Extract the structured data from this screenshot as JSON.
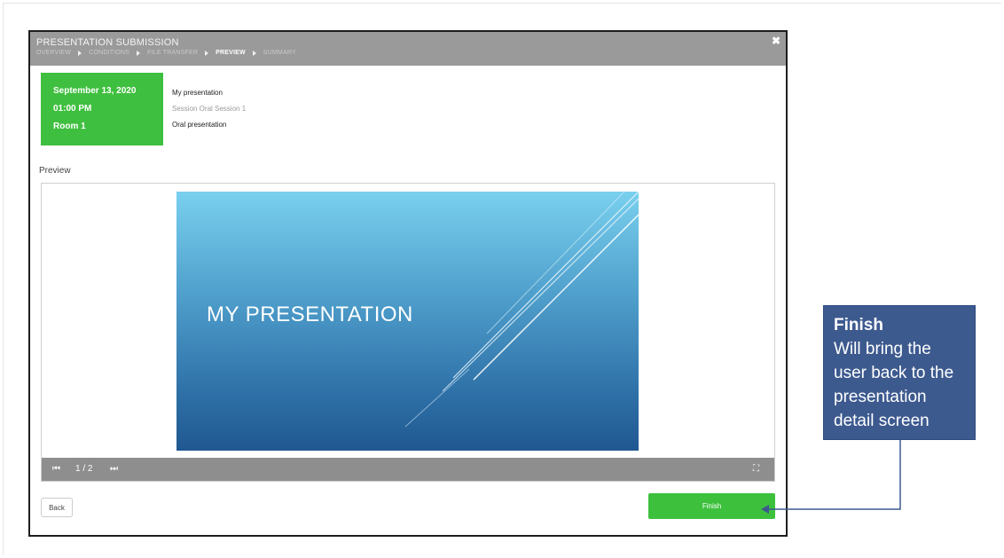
{
  "modal": {
    "title": "PRESENTATION SUBMISSION",
    "close_icon": "close-icon",
    "steps": [
      {
        "label": "OVERVIEW",
        "active": false
      },
      {
        "label": "CONDITIONS",
        "active": false
      },
      {
        "label": "FILE TRANSFER",
        "active": false
      },
      {
        "label": "PREVIEW",
        "active": true
      },
      {
        "label": "SUMMARY",
        "active": false
      }
    ]
  },
  "session": {
    "date": "September 13, 2020",
    "time": "01:00 PM",
    "room": "Room 1",
    "title": "My presentation",
    "session_name": "Session Oral Session 1",
    "type": "Oral presentation",
    "card_color": "#3fbf3f"
  },
  "preview": {
    "label": "Preview",
    "slide_title": "MY PRESENTATION",
    "page_indicator": "1 / 2",
    "icons": [
      "first-page-icon",
      "next-page-icon",
      "fullscreen-icon"
    ]
  },
  "actions": {
    "back_label": "Back",
    "finish_label": "Finish",
    "finish_color": "#3dc13d"
  },
  "callout": {
    "title": "Finish",
    "lines": [
      "Will bring the",
      "user back to the",
      "presentation",
      "detail screen"
    ],
    "color": "#3d5a8f"
  }
}
